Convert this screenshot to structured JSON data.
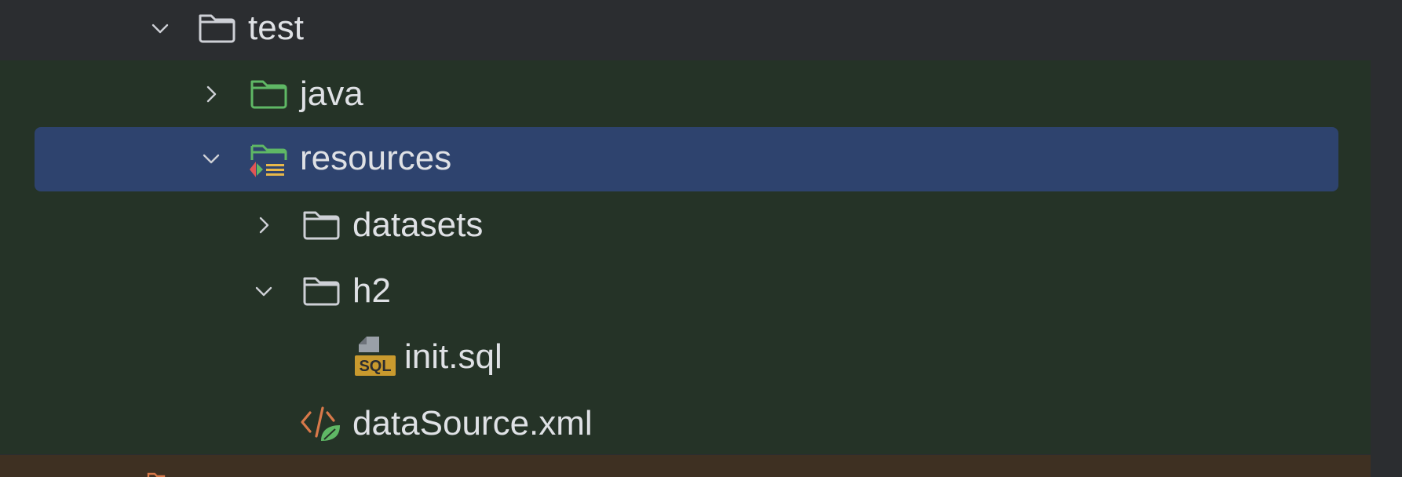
{
  "project_tree": {
    "items": [
      {
        "label": "test",
        "icon": "folder-icon",
        "expanded": true
      },
      {
        "label": "java",
        "icon": "test-sources-folder-icon",
        "expanded": false
      },
      {
        "label": "resources",
        "icon": "test-resources-folder-icon",
        "expanded": true,
        "selected": true
      },
      {
        "label": "datasets",
        "icon": "folder-icon",
        "expanded": false
      },
      {
        "label": "h2",
        "icon": "folder-icon",
        "expanded": true
      },
      {
        "label": "init.sql",
        "icon": "sql-file-icon",
        "badge": "SQL"
      },
      {
        "label": "dataSource.xml",
        "icon": "spring-xml-file-icon"
      }
    ]
  },
  "colors": {
    "background": "#2b2d30",
    "test_scope_background": "#253327",
    "selection": "#2e436e",
    "next_scope_background": "#3e3022",
    "test_folder_green": "#5fb865",
    "sql_badge": "#c99a2e",
    "xml_orange": "#d8794a"
  }
}
